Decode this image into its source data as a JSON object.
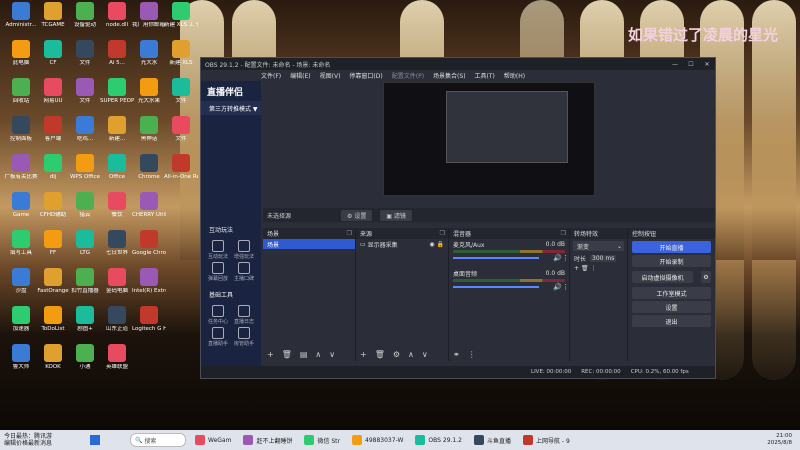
{
  "watermark": "如果错过了凌晨的星光",
  "desktop_icons": [
    {
      "label": "Administr..."
    },
    {
      "label": "TCGAME"
    },
    {
      "label": "设备驱动"
    },
    {
      "label": "node.dll"
    },
    {
      "label": "我厂用你邮箱 协议和说明..."
    },
    {
      "label": "新建 XLS 工 作表.xls"
    },
    {
      "label": "此电脑"
    },
    {
      "label": "CF"
    },
    {
      "label": "文件"
    },
    {
      "label": "Ai 5..."
    },
    {
      "label": "光大水"
    },
    {
      "label": "新建 XLS"
    },
    {
      "label": "回收站"
    },
    {
      "label": "网易UU"
    },
    {
      "label": "文件"
    },
    {
      "label": "SUPER PEOP..."
    },
    {
      "label": "光大水果"
    },
    {
      "label": "文件"
    },
    {
      "label": "控制面板"
    },
    {
      "label": "客户端"
    },
    {
      "label": "吃鸡..."
    },
    {
      "label": "新建..."
    },
    {
      "label": "黑神话"
    },
    {
      "label": "文件"
    },
    {
      "label": "广板有关比赛"
    },
    {
      "label": "dlj"
    },
    {
      "label": "WPS Office"
    },
    {
      "label": "Office"
    },
    {
      "label": "Chrome"
    },
    {
      "label": "All-in-One Repair Pr..."
    },
    {
      "label": "Game"
    },
    {
      "label": "CFHD辅助"
    },
    {
      "label": "猎云"
    },
    {
      "label": "餐饮"
    },
    {
      "label": "CHERRY Utility..."
    },
    {
      "label": "填写工具"
    },
    {
      "label": "FF"
    },
    {
      "label": "LTG"
    },
    {
      "label": "七日世界"
    },
    {
      "label": "Google Chrome"
    },
    {
      "label": "沙盘"
    },
    {
      "label": "FastOrange"
    },
    {
      "label": "扣竹直播器"
    },
    {
      "label": "金码电脑"
    },
    {
      "label": "Intel(R) Extre..."
    },
    {
      "label": "加速器"
    },
    {
      "label": "ToDoList"
    },
    {
      "label": "剧图+"
    },
    {
      "label": "山东正道"
    },
    {
      "label": "Logitech G HUB"
    },
    {
      "label": "鲁大师"
    },
    {
      "label": "KOOK"
    },
    {
      "label": "小通"
    },
    {
      "label": "英雄联盟"
    }
  ],
  "obs": {
    "title": "OBS 29.1.2 - 配置文件: 未命名 - 场景: 未命名",
    "menu": [
      "文件(F)",
      "编辑(E)",
      "视图(V)",
      "停靠窗口(D)",
      "配置文件(P)",
      "场景集合(S)",
      "工具(T)",
      "帮助(H)"
    ],
    "sidebar": {
      "brand": "直播伴侣",
      "mode": "第三方转推模式 ▼",
      "section1": "互动玩法",
      "grid1": [
        "互动玩法",
        "增强玩法",
        "弹幕回放",
        "主播口碑"
      ],
      "section2": "基础工具",
      "grid2": [
        "任务中心",
        "直播日志",
        "直播助手",
        "房管助手"
      ]
    },
    "subbar": {
      "label": "未选择源",
      "settings": "设置",
      "filters": "滤镜"
    },
    "docks": {
      "scenes": {
        "title": "场景",
        "items": [
          "场景"
        ]
      },
      "sources": {
        "title": "来源",
        "items": [
          "显示器采集"
        ]
      },
      "mixer": {
        "title": "混音器",
        "channels": [
          {
            "name": "麦克风/Aux",
            "db": "0.0 dB"
          },
          {
            "name": "桌面音频",
            "db": "0.0 dB"
          }
        ]
      },
      "transitions": {
        "title": "转场特效",
        "type": "渐变",
        "duration_label": "时长",
        "duration": "300 ms"
      },
      "controls": {
        "title": "控制按钮",
        "buttons": [
          "开始直播",
          "开始录制",
          "启动虚拟摄像机",
          "工作室模式",
          "设置",
          "退出"
        ]
      }
    },
    "status": {
      "live": "LIVE: 00:00:00",
      "rec": "REC: 00:00:00",
      "cpu": "CPU: 0.2%, 60.00 fps"
    }
  },
  "taskbar": {
    "weather_line1": "今日最热：腾讯游",
    "weather_line2": "编辑价格最新消息",
    "search": "搜索",
    "apps": [
      "WeGam",
      "赶不上翻睡饼",
      "微信 Str",
      "49883037-W",
      "OBS 29.1.2",
      "斗鱼直播",
      "上网导航 - 9"
    ],
    "time": "21:00",
    "date": "2025/8/8"
  }
}
